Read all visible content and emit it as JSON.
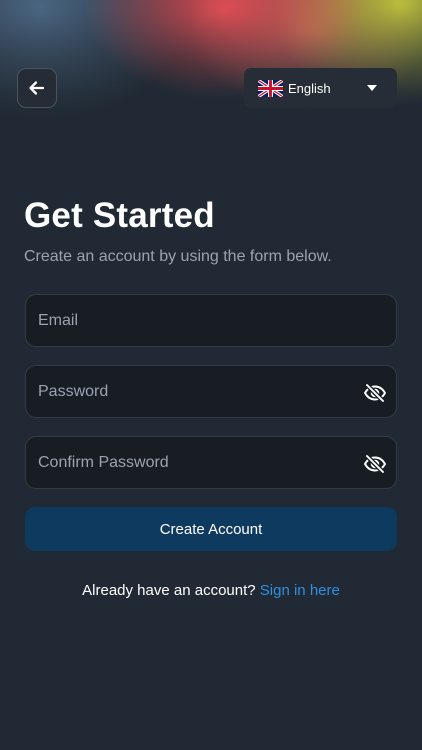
{
  "header": {
    "back_icon": "arrow-left-icon",
    "language": {
      "flag_icon": "uk-flag-icon",
      "label": "English",
      "caret_icon": "caret-down-icon"
    }
  },
  "main": {
    "title": "Get Started",
    "subtitle": "Create an account by using the form below.",
    "fields": {
      "email": {
        "placeholder": "Email",
        "value": ""
      },
      "password": {
        "placeholder": "Password",
        "value": "",
        "toggle_icon": "eye-off-icon"
      },
      "confirm_password": {
        "placeholder": "Confirm Password",
        "value": "",
        "toggle_icon": "eye-off-icon"
      }
    },
    "submit_label": "Create Account",
    "signin": {
      "prompt": "Already have an account?",
      "link": "Sign in here"
    }
  },
  "colors": {
    "background": "#212a34",
    "field_background": "#181d24",
    "primary_button": "#0f3a5f",
    "link": "#2f8fe0",
    "muted_text": "#9aa3ae"
  }
}
